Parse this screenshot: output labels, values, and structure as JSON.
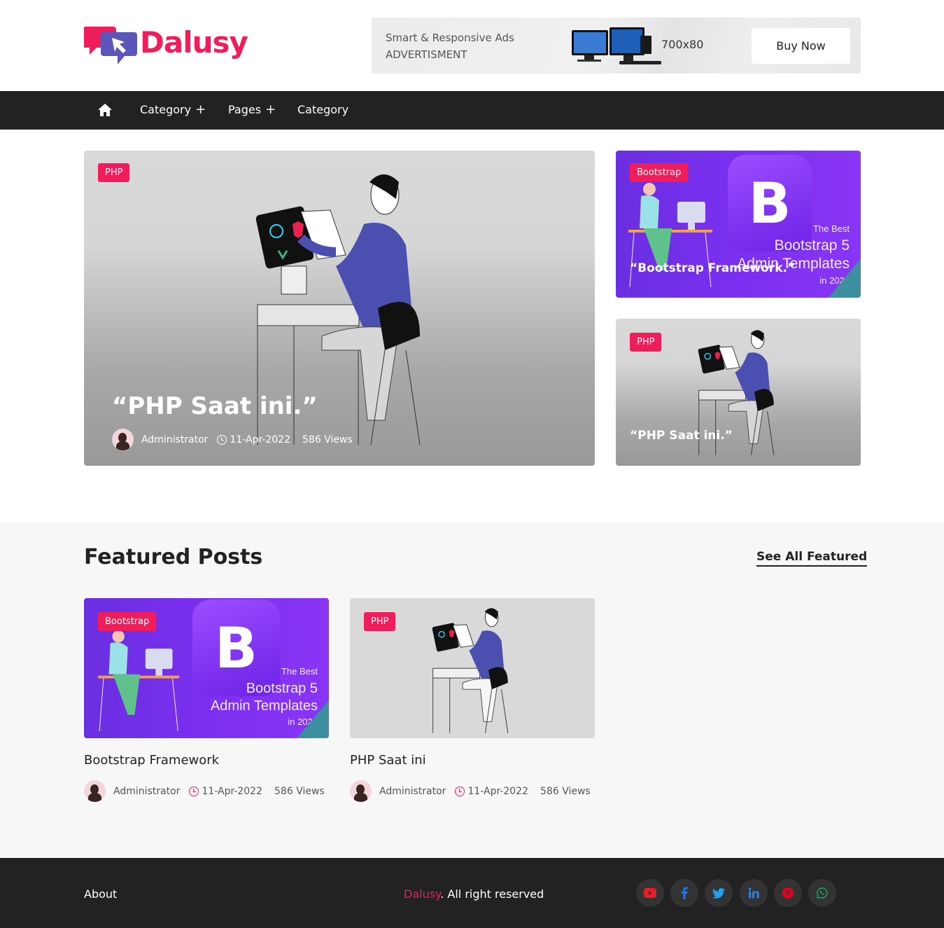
{
  "header": {
    "logo_text": "Dalusy",
    "ad": {
      "line1": "Smart & Responsive Ads",
      "line2": "ADVERTISMENT",
      "size": "700x80",
      "buy_label": "Buy Now"
    }
  },
  "nav": {
    "items": [
      {
        "label": "Category"
      },
      {
        "label": "Pages"
      },
      {
        "label": "Category"
      }
    ],
    "plus": "+"
  },
  "hero": {
    "main": {
      "tag": "PHP",
      "title": "“PHP Saat ini.”",
      "author": "Administrator",
      "date": "11-Apr-2022",
      "views": "586 Views"
    },
    "side": [
      {
        "tag": "Bootstrap",
        "title": "“Bootstrap Framework.”"
      },
      {
        "tag": "PHP",
        "title": "“PHP Saat ini.”"
      }
    ]
  },
  "bootstrap_art": {
    "the_best": "The Best",
    "line1": "Bootstrap 5",
    "line2": "Admin Templates",
    "year": "in 2021",
    "letter": "B"
  },
  "featured": {
    "title": "Featured Posts",
    "see_all": "See All Featured",
    "posts": [
      {
        "tag": "Bootstrap",
        "title": "Bootstrap Framework",
        "author": "Administrator",
        "date": "11-Apr-2022",
        "views": "586 Views"
      },
      {
        "tag": "PHP",
        "title": "PHP Saat ini",
        "author": "Administrator",
        "date": "11-Apr-2022",
        "views": "586 Views"
      }
    ]
  },
  "footer": {
    "about": "About",
    "brand": "Dalusy",
    "rights": ". All right reserved",
    "social_icons": [
      "youtube-icon",
      "facebook-icon",
      "twitter-icon",
      "linkedin-icon",
      "pinterest-icon",
      "whatsapp-icon"
    ]
  },
  "colors": {
    "accent": "#ef1e5a",
    "nav_bg": "#222222",
    "purple": "#7b2ff0"
  }
}
